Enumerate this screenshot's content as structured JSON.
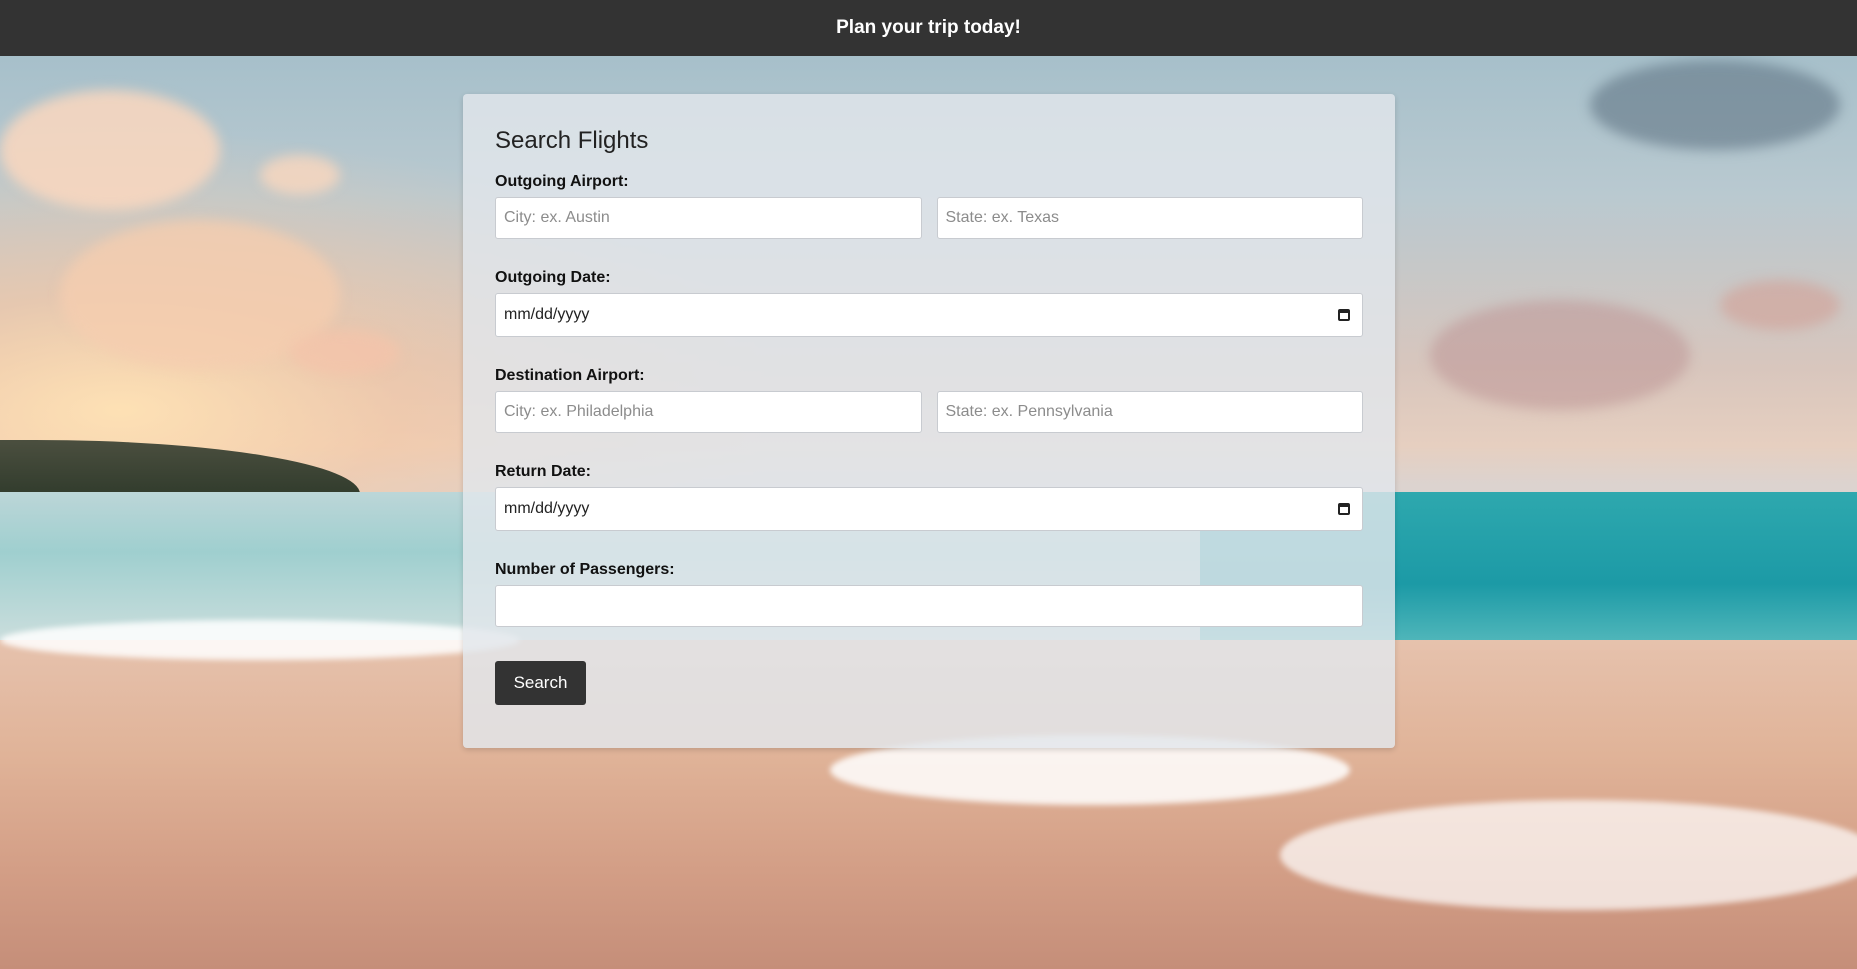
{
  "header": {
    "title": "Plan your trip today!",
    "background": "#333333"
  },
  "form": {
    "title": "Search Flights",
    "outgoing_airport": {
      "label": "Outgoing Airport:",
      "city_placeholder": "City: ex. Austin",
      "state_placeholder": "State: ex. Texas"
    },
    "outgoing_date": {
      "label": "Outgoing Date:",
      "value": "mm/dd/yyyy",
      "icon": "calendar-icon"
    },
    "destination_airport": {
      "label": "Destination Airport:",
      "city_placeholder": "City: ex. Philadelphia",
      "state_placeholder": "State: ex. Pennsylvania"
    },
    "return_date": {
      "label": "Return Date:",
      "value": "mm/dd/yyyy",
      "icon": "calendar-icon"
    },
    "passengers": {
      "label": "Number of Passengers:",
      "value": ""
    },
    "search_label": "Search",
    "button_color": "#333333"
  }
}
